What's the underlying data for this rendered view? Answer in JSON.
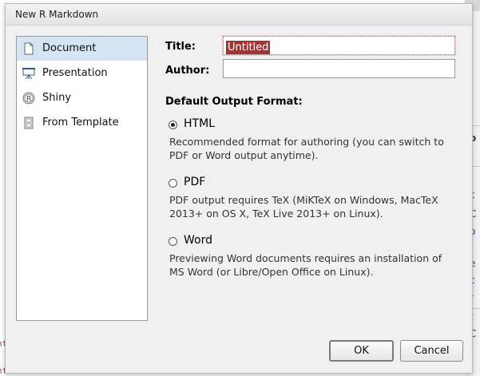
{
  "dialog": {
    "title": "New R Markdown"
  },
  "sidebar": {
    "items": [
      {
        "label": "Document",
        "icon": "document-icon",
        "selected": true
      },
      {
        "label": "Presentation",
        "icon": "presentation-icon",
        "selected": false
      },
      {
        "label": "Shiny",
        "icon": "shiny-icon",
        "selected": false
      },
      {
        "label": "From Template",
        "icon": "template-icon",
        "selected": false
      }
    ]
  },
  "form": {
    "title_label": "Title:",
    "title_value": "Untitled",
    "author_label": "Author:",
    "author_value": "",
    "default_output_label": "Default Output Format:"
  },
  "output_formats": [
    {
      "label": "HTML",
      "checked": true,
      "description": "Recommended format for authoring (you can switch to PDF or Word output anytime)."
    },
    {
      "label": "PDF",
      "checked": false,
      "description": "PDF output requires TeX (MiKTeX on Windows, MacTeX 2013+ on OS X, TeX Live 2013+ on Linux)."
    },
    {
      "label": "Word",
      "checked": false,
      "description": "Previewing Word documents requires an installation of MS Word (or Libre/Open Office on Linux)."
    }
  ],
  "buttons": {
    "ok": "OK",
    "cancel": "Cancel"
  },
  "background": {
    "right_fragments": [
      "o",
      "c",
      "C",
      "o",
      "e",
      "c",
      "r",
      "t",
      "C"
    ],
    "left_fragments": [
      "nt",
      "nt tb"
    ]
  }
}
